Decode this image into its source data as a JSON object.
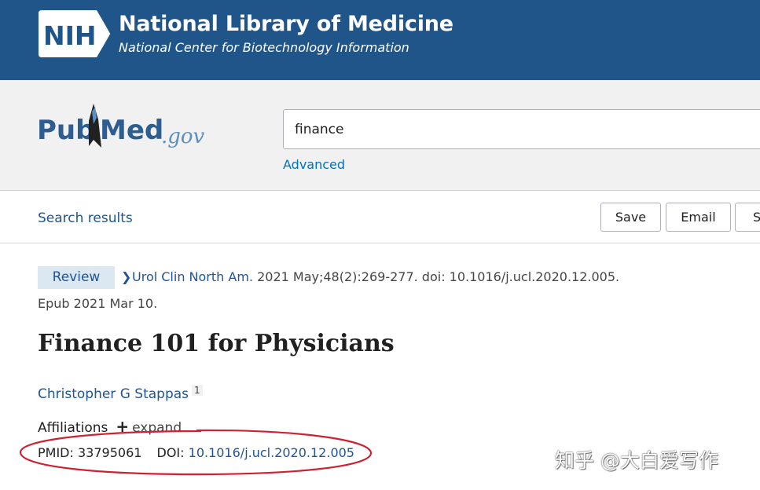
{
  "nih_banner": {
    "logo_text": "NIH",
    "title": "National Library of Medicine",
    "subtitle": "National Center for Biotechnology Information"
  },
  "search": {
    "logo_text_pub": "Pub",
    "logo_text_med": "Med",
    "logo_text_gov": ".gov",
    "query": "finance",
    "advanced_label": "Advanced"
  },
  "action_bar": {
    "search_results_label": "Search results",
    "save_label": "Save",
    "email_label": "Email",
    "send_label": "S"
  },
  "article": {
    "publication_type": "Review",
    "journal": "Urol Clin North Am.",
    "citation": " 2021 May;48(2):269-277. doi: 10.1016/j.ucl.2020.12.005.",
    "epub": "Epub 2021 Mar 10.",
    "title": "Finance 101 for Physicians",
    "author": "Christopher G Stappas",
    "author_affiliation_ref": "1",
    "affiliations_label": "Affiliations",
    "expand_label": "expand",
    "pmid_label": "PMID:",
    "pmid": "33795061",
    "doi_label": "DOI:",
    "doi": "10.1016/j.ucl.2020.12.005"
  },
  "annotation": {
    "color": "#cc2233"
  },
  "watermark": {
    "text": "知乎 @大白爱写作"
  },
  "colors": {
    "nih_blue": "#20558a",
    "link_blue": "#205493",
    "pubmed_dark": "#2e5d8f",
    "pubmed_light": "#5a8fc2"
  }
}
